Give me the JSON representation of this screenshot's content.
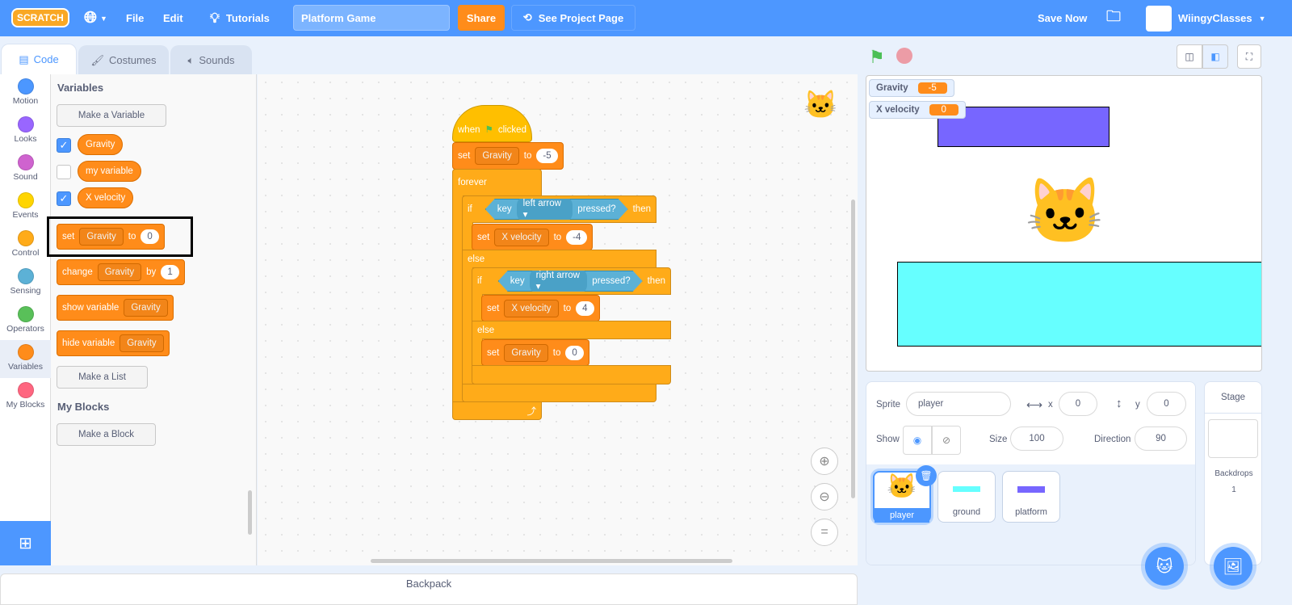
{
  "menu": {
    "logo": "SCRATCH",
    "file": "File",
    "edit": "Edit",
    "tutorials": "Tutorials",
    "project_title": "Platform Game",
    "share": "Share",
    "see_project": "See Project Page",
    "save_now": "Save Now",
    "user": "WiingyClasses"
  },
  "tabs": [
    {
      "label": "Code"
    },
    {
      "label": "Costumes"
    },
    {
      "label": "Sounds"
    }
  ],
  "categories": [
    {
      "label": "Motion",
      "color": "#4c97ff"
    },
    {
      "label": "Looks",
      "color": "#9966ff"
    },
    {
      "label": "Sound",
      "color": "#cf63cf"
    },
    {
      "label": "Events",
      "color": "#ffd500"
    },
    {
      "label": "Control",
      "color": "#ffab19"
    },
    {
      "label": "Sensing",
      "color": "#5cb1d6"
    },
    {
      "label": "Operators",
      "color": "#59c059"
    },
    {
      "label": "Variables",
      "color": "#ff8c1a"
    },
    {
      "label": "My Blocks",
      "color": "#ff6680"
    }
  ],
  "palette": {
    "heading": "Variables",
    "make_variable": "Make a Variable",
    "variables": [
      {
        "name": "Gravity",
        "checked": true
      },
      {
        "name": "my variable",
        "checked": false
      },
      {
        "name": "X velocity",
        "checked": true
      }
    ],
    "set_block": {
      "verb": "set",
      "var": "Gravity",
      "to": "to",
      "value": "0"
    },
    "change_block": {
      "verb": "change",
      "var": "Gravity",
      "by": "by",
      "value": "1"
    },
    "show_block": {
      "verb": "show variable",
      "var": "Gravity"
    },
    "hide_block": {
      "verb": "hide variable",
      "var": "Gravity"
    },
    "make_list": "Make a List",
    "myblocks_heading": "My Blocks",
    "make_block": "Make a Block"
  },
  "script": {
    "hat": {
      "when": "when",
      "clicked": "clicked"
    },
    "set1": {
      "verb": "set",
      "var": "Gravity",
      "to": "to",
      "value": "-5"
    },
    "forever": "forever",
    "if1": {
      "if": "if",
      "key": "key",
      "option": "left arrow",
      "pressed": "pressed?",
      "then": "then"
    },
    "set2": {
      "verb": "set",
      "var": "X velocity",
      "to": "to",
      "value": "-4"
    },
    "else1": "else",
    "if2": {
      "if": "if",
      "key": "key",
      "option": "right arrow",
      "pressed": "pressed?",
      "then": "then"
    },
    "set3": {
      "verb": "set",
      "var": "X velocity",
      "to": "to",
      "value": "4"
    },
    "else2": "else",
    "set4": {
      "verb": "set",
      "var": "Gravity",
      "to": "to",
      "value": "0"
    }
  },
  "backpack": "Backpack",
  "stage": {
    "monitors": [
      {
        "name": "Gravity",
        "value": "-5"
      },
      {
        "name": "X velocity",
        "value": "0"
      }
    ],
    "platform_color": "#7766ff",
    "ground_color": "#66ffff"
  },
  "sprite_info": {
    "sprite_label": "Sprite",
    "sprite_name": "player",
    "x_label": "x",
    "x": "0",
    "y_label": "y",
    "y": "0",
    "show_label": "Show",
    "size_label": "Size",
    "size": "100",
    "direction_label": "Direction",
    "direction": "90"
  },
  "sprites": [
    {
      "name": "player",
      "selected": true
    },
    {
      "name": "ground"
    },
    {
      "name": "platform"
    }
  ],
  "stage_pane": {
    "title": "Stage",
    "backdrops_label": "Backdrops",
    "backdrops": "1"
  }
}
